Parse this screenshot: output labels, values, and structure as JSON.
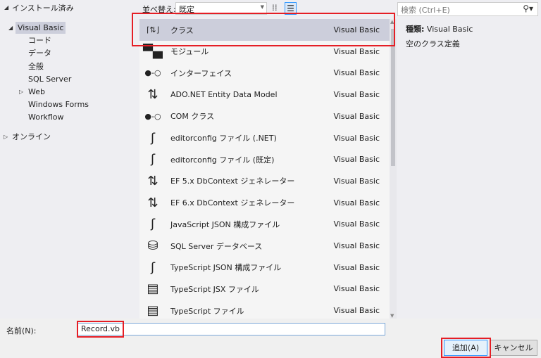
{
  "tree": {
    "installed": "インストール済み",
    "visual_basic": "Visual Basic",
    "children": [
      "コード",
      "データ",
      "全般",
      "SQL Server",
      "Web",
      "Windows Forms",
      "Workflow"
    ],
    "online": "オンライン"
  },
  "toolbar": {
    "sort_label": "並べ替え:",
    "sort_value": "既定"
  },
  "templates": [
    {
      "name": "クラス",
      "lang": "Visual Basic",
      "icon": "vb-class-icon"
    },
    {
      "name": "モジュール",
      "lang": "Visual Basic",
      "icon": "module-icon"
    },
    {
      "name": "インターフェイス",
      "lang": "Visual Basic",
      "icon": "interface-icon"
    },
    {
      "name": "ADO.NET Entity Data Model",
      "lang": "Visual Basic",
      "icon": "entity-model-icon"
    },
    {
      "name": "COM クラス",
      "lang": "Visual Basic",
      "icon": "interface-icon"
    },
    {
      "name": "editorconfig ファイル (.NET)",
      "lang": "Visual Basic",
      "icon": "config-file-icon"
    },
    {
      "name": "editorconfig ファイル (既定)",
      "lang": "Visual Basic",
      "icon": "config-file-icon"
    },
    {
      "name": "EF 5.x DbContext ジェネレーター",
      "lang": "Visual Basic",
      "icon": "entity-model-icon"
    },
    {
      "name": "EF 6.x DbContext ジェネレーター",
      "lang": "Visual Basic",
      "icon": "entity-model-icon"
    },
    {
      "name": "JavaScript JSON 構成ファイル",
      "lang": "Visual Basic",
      "icon": "json-file-icon"
    },
    {
      "name": "SQL Server データベース",
      "lang": "Visual Basic",
      "icon": "database-icon"
    },
    {
      "name": "TypeScript JSON 構成ファイル",
      "lang": "Visual Basic",
      "icon": "json-file-icon"
    },
    {
      "name": "TypeScript JSX ファイル",
      "lang": "Visual Basic",
      "icon": "typescript-file-icon"
    },
    {
      "name": "TypeScript ファイル",
      "lang": "Visual Basic",
      "icon": "typescript-file-icon"
    }
  ],
  "search": {
    "placeholder": "検索 (Ctrl+E)"
  },
  "details": {
    "type_label": "種類:",
    "type_value": "Visual Basic",
    "description": "空のクラス定義"
  },
  "name_field": {
    "label": "名前(N):",
    "value": "Record.vb"
  },
  "buttons": {
    "add": "追加(A)",
    "cancel": "キャンセル"
  },
  "colors": {
    "highlight": "#e51e25",
    "selection": "#cccedb",
    "accent": "#3399ff"
  }
}
